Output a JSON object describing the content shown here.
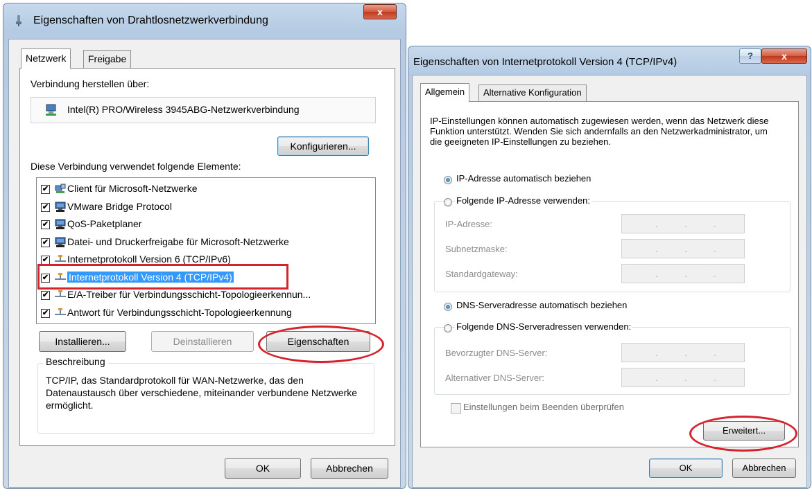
{
  "left_dialog": {
    "title": "Eigenschaften von Drahtlosnetzwerkverbindung",
    "close_label": "x",
    "tabs": [
      "Netzwerk",
      "Freigabe"
    ],
    "connect_via_label": "Verbindung herstellen über:",
    "adapter_name": "Intel(R) PRO/Wireless 3945ABG-Netzwerkverbindung",
    "configure_button": "Konfigurieren...",
    "elements_label": "Diese Verbindung verwendet folgende Elemente:",
    "items": [
      {
        "label": "Client für Microsoft-Netzwerke",
        "checked": true,
        "icon": "network-client-icon"
      },
      {
        "label": "VMware Bridge Protocol",
        "checked": true,
        "icon": "computer-service-icon"
      },
      {
        "label": "QoS-Paketplaner",
        "checked": true,
        "icon": "computer-service-icon"
      },
      {
        "label": "Datei- und Druckerfreigabe für Microsoft-Netzwerke",
        "checked": true,
        "icon": "computer-service-icon"
      },
      {
        "label": "Internetprotokoll Version 6 (TCP/IPv6)",
        "checked": true,
        "icon": "protocol-icon"
      },
      {
        "label": "Internetprotokoll Version 4 (TCP/IPv4)",
        "checked": true,
        "icon": "protocol-icon",
        "selected": true
      },
      {
        "label": "E/A-Treiber für Verbindungsschicht-Topologieerkennun...",
        "checked": true,
        "icon": "protocol-icon"
      },
      {
        "label": "Antwort für Verbindungsschicht-Topologieerkennung",
        "checked": true,
        "icon": "protocol-icon"
      }
    ],
    "install_button": "Installieren...",
    "uninstall_button": "Deinstallieren",
    "properties_button": "Eigenschaften",
    "description_label": "Beschreibung",
    "description_text": "TCP/IP, das Standardprotokoll für WAN-Netzwerke, das den Datenaustausch über verschiedene, miteinander verbundene Netzwerke ermöglicht.",
    "ok_button": "OK",
    "cancel_button": "Abbrechen"
  },
  "right_dialog": {
    "title": "Eigenschaften von Internetprotokoll Version 4 (TCP/IPv4)",
    "help_label": "?",
    "close_label": "x",
    "tabs": [
      "Allgemein",
      "Alternative Konfiguration"
    ],
    "intro_text": "IP-Einstellungen können automatisch zugewiesen werden, wenn das Netzwerk diese Funktion unterstützt. Wenden Sie sich andernfalls an den Netzwerkadministrator, um die geeigneten IP-Einstellungen zu beziehen.",
    "ip_auto_label": "IP-Adresse automatisch beziehen",
    "ip_manual_label": "Folgende IP-Adresse verwenden:",
    "ip_auto_selected": true,
    "ip_fields": [
      "IP-Adresse:",
      "Subnetzmaske:",
      "Standardgateway:"
    ],
    "dns_auto_label": "DNS-Serveradresse automatisch beziehen",
    "dns_manual_label": "Folgende DNS-Serveradressen verwenden:",
    "dns_auto_selected": true,
    "dns_fields": [
      "Bevorzugter DNS-Server:",
      "Alternativer DNS-Server:"
    ],
    "validate_label": "Einstellungen beim Beenden überprüfen",
    "advanced_button": "Erweitert...",
    "ok_button": "OK",
    "cancel_button": "Abbrechen"
  },
  "colors": {
    "highlight_red": "#d4232b",
    "selection_blue": "#3399ff"
  }
}
